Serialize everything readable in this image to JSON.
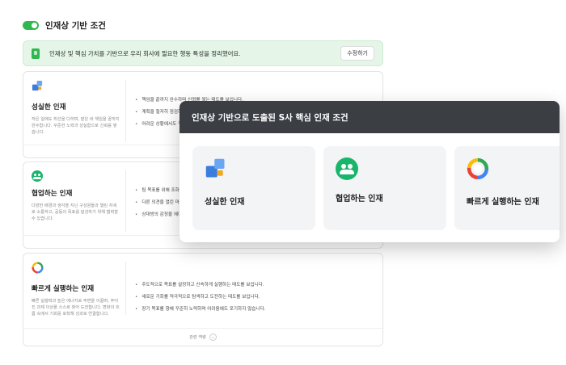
{
  "header": {
    "title": "인재상 기반 조건",
    "toggle_on": true,
    "toggle_color": "#2fb84f"
  },
  "banner": {
    "text": "인재상 및 핵심 가치를 기반으로 우리 회사에 필요한 행동 특성을 정리했어요.",
    "edit_label": "수정하기",
    "bg_color": "#e5f6e9"
  },
  "cards": [
    {
      "icon": "puzzle-icon",
      "title": "성실한 인재",
      "desc": "작은 일에도 최선을 다하며, 맡은 바 책임을 끝까지 완수합니다. 꾸준한 노력과 성실함으로 신뢰를 쌓습니다.",
      "bullets": [
        "책임을 끝까지 완수하며 신뢰를 쌓는 태도를 보입니다.",
        "계획을 철저히 점검하며 성실하게 업무를 수행합니다.",
        "어려운 상황에서도 꾸준히 노력하는 자세를 유지합니다."
      ]
    },
    {
      "icon": "team-icon",
      "title": "협업하는 인재",
      "desc": "다양한 배경과 생각을 지닌 구성원들과 열린 자세로 소통하고, 공동의 목표를 달성하기 위해 협력할 수 있습니다.",
      "bullets": [
        "팀 목표를 위해 조화롭게 협력하는 태도를 보입니다.",
        "다른 의견을 열린 마음으로 경청하고 존중합니다.",
        "상대방의 감정을 헤아리며 원활하게 소통합니다."
      ]
    },
    {
      "icon": "google-g-icon",
      "title": "빠르게 실행하는 인재",
      "desc": "빠른 실행력과 높은 에너지로 주변을 이끌며, 주어진 과제 이상을 스스로 찾아 도전합니다. 변화의 흐름 속에서 기회를 포착해 성과로 연결합니다.",
      "bullets": [
        "주도적으로 목표를 설정하고 신속하게 실행하는 태도를 보입니다.",
        "새로운 기회를 적극적으로 탐색하고 도전하는 태도를 보입니다.",
        "장기 목표를 향해 꾸준히 노력하며 어려움에도 포기하지 않습니다."
      ]
    }
  ],
  "more_label": "관련 역량",
  "modal": {
    "title": "인재상 기반으로 도출된 S사 핵심 인재 조건",
    "header_color": "#3b3e43",
    "tiles": [
      {
        "icon": "puzzle-icon",
        "title": "성실한 인재"
      },
      {
        "icon": "team-icon",
        "title": "협업하는 인재"
      },
      {
        "icon": "google-g-icon",
        "title": "빠르게 실행하는 인재"
      }
    ]
  }
}
